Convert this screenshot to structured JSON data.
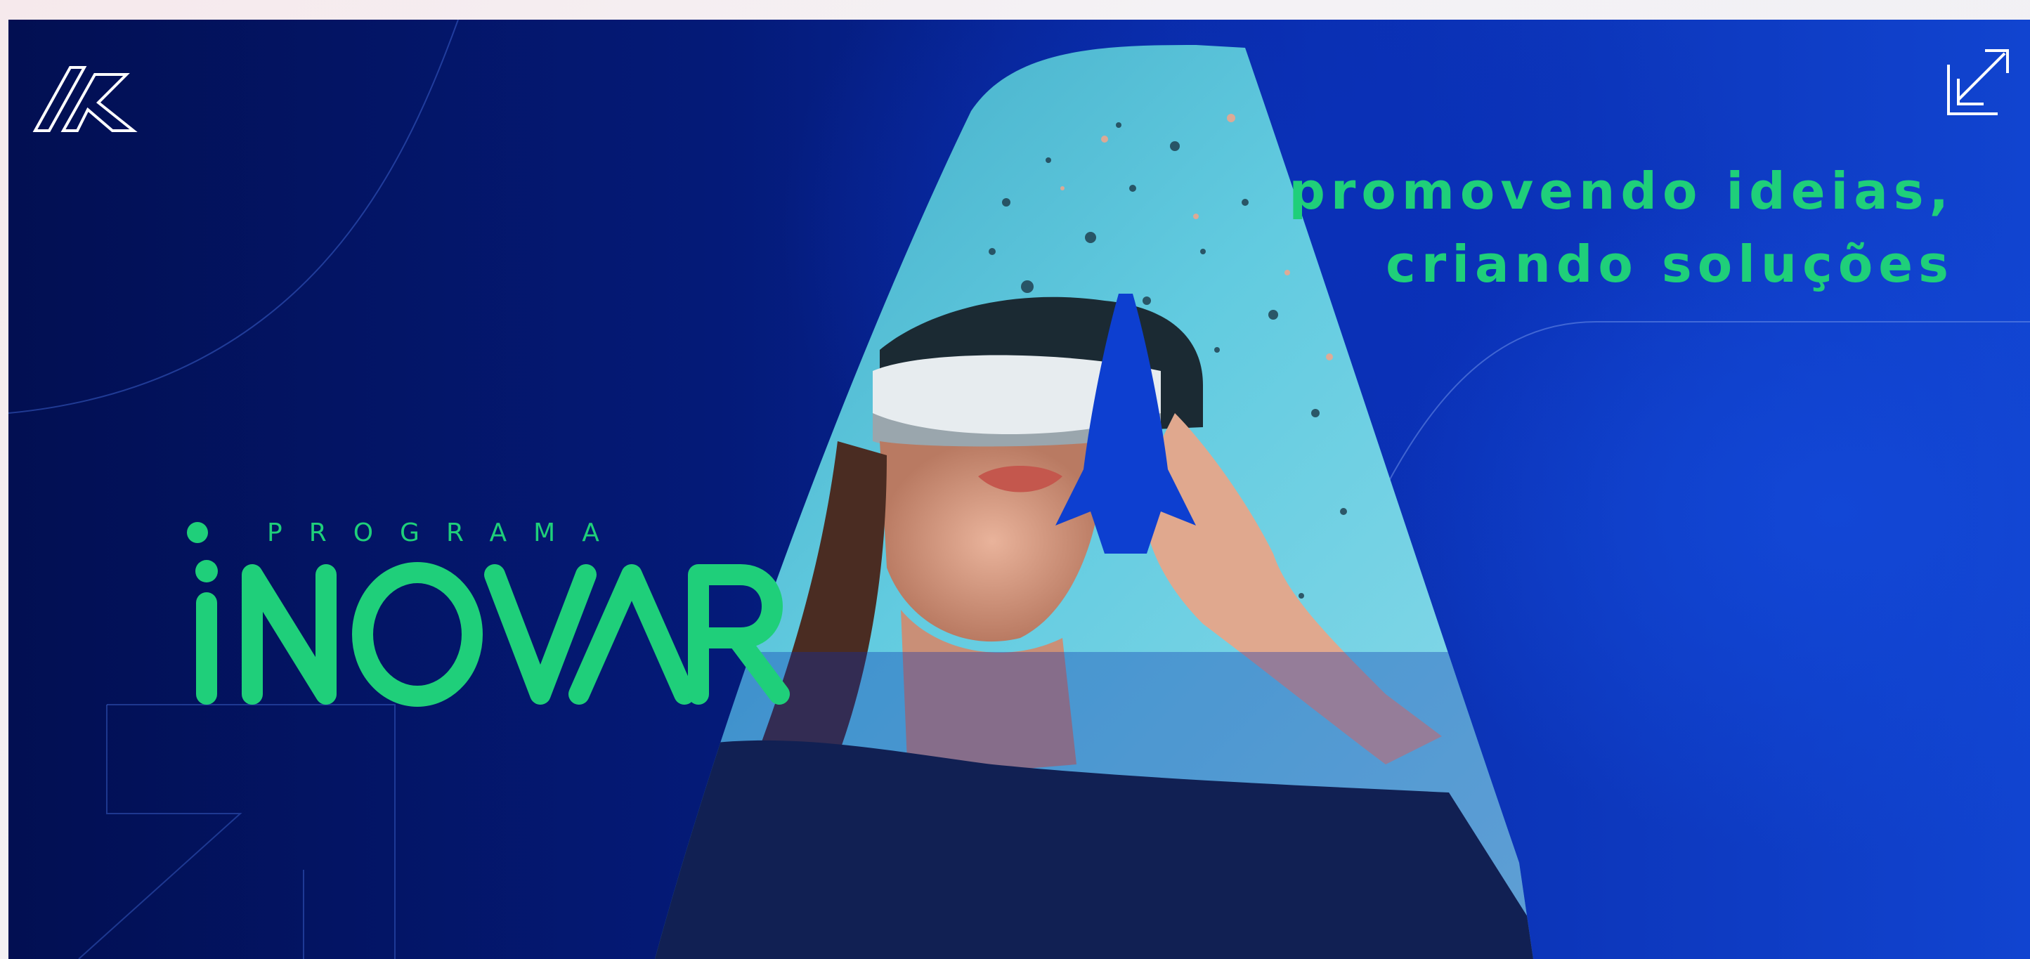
{
  "banner": {
    "tagline_line1": "promovendo ideias,",
    "tagline_line2": "criando soluções",
    "program_label": "PROGRAMA",
    "program_name": "INOVAR",
    "colors": {
      "accent_green": "#1fcf7a",
      "deep_navy": "#020f52",
      "royal_blue": "#1144d0",
      "photo_cyan": "#5cc9e0"
    },
    "icons": [
      "brand-logo-icon",
      "corner-arrow-icon",
      "rocket-icon"
    ]
  }
}
